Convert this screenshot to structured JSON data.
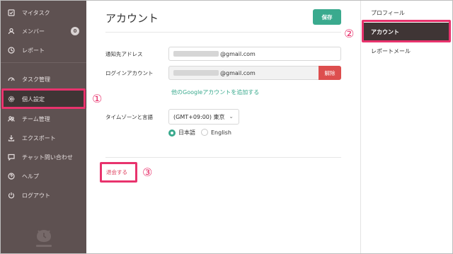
{
  "sidebar": {
    "items": [
      {
        "label": "マイタスク",
        "icon": "checkbox-icon"
      },
      {
        "label": "メンバー",
        "icon": "person-icon",
        "badge": "0"
      },
      {
        "label": "レポート",
        "icon": "clock-icon"
      },
      {
        "label": "タスク管理",
        "icon": "gauge-icon"
      },
      {
        "label": "個人設定",
        "icon": "gear-icon"
      },
      {
        "label": "チーム管理",
        "icon": "team-icon"
      },
      {
        "label": "エクスポート",
        "icon": "download-icon"
      },
      {
        "label": "チャット問い合わせ",
        "icon": "chat-icon"
      },
      {
        "label": "ヘルプ",
        "icon": "help-icon"
      },
      {
        "label": "ログアウト",
        "icon": "power-icon"
      }
    ]
  },
  "main": {
    "title": "アカウント",
    "save_label": "保存",
    "notify_label": "通知先アドレス",
    "notify_value": "@gmail.com",
    "login_label": "ログインアカウント",
    "login_value": "@gmail.com",
    "unlink_label": "解除",
    "add_google_link": "他のGoogleアカウントを追加する",
    "timezone_label": "タイムゾーンと言語",
    "timezone_value": "(GMT+09:00) 東京",
    "lang_ja": "日本語",
    "lang_en": "English",
    "withdraw_label": "退会する"
  },
  "right_panel": {
    "items": [
      "プロフィール",
      "アカウント",
      "レポートメール"
    ]
  },
  "annotations": {
    "n1": "①",
    "n2": "②",
    "n3": "③"
  },
  "colors": {
    "accent": "#3aaa8e",
    "danger": "#dd4e4e",
    "sidebar": "#5e5151",
    "highlight": "#e8336d"
  }
}
